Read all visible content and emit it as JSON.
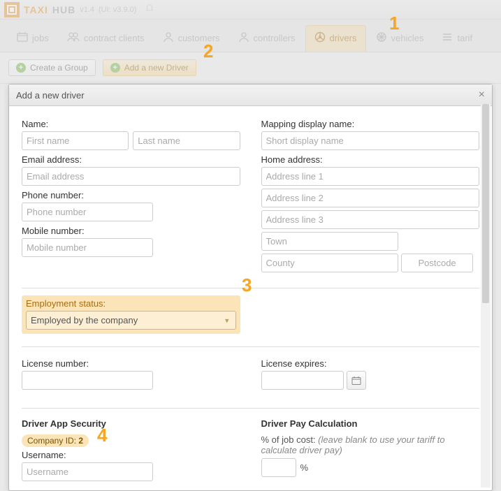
{
  "brand": {
    "part1": "TAXI",
    "part2": "HUB",
    "ver": "v1.4",
    "uiver": "(UI: v3.9.0)"
  },
  "tabs": {
    "jobs": "jobs",
    "contract": "contract clients",
    "customers": "customers",
    "controllers": "controllers",
    "drivers": "drivers",
    "vehicles": "vehicles",
    "tariffs": "tarif"
  },
  "toolbar": {
    "create_group": "Create a Group",
    "add_driver": "Add a new Driver"
  },
  "modal": {
    "title": "Add a new driver",
    "labels": {
      "name": "Name:",
      "email": "Email address:",
      "phone": "Phone number:",
      "mobile": "Mobile number:",
      "mapping": "Mapping display name:",
      "home": "Home address:",
      "employment": "Employment status:",
      "license_no": "License number:",
      "license_exp": "License expires:",
      "sec_title": "Driver App Security",
      "company_id_label": "Company ID:",
      "company_id_value": "2",
      "username": "Username:",
      "pay_title": "Driver Pay Calculation",
      "pct_label": "% of job cost:",
      "pct_hint": "(leave blank to use your tariff to calculate driver pay)",
      "pct_sign": "%"
    },
    "placeholders": {
      "first": "First name",
      "last": "Last name",
      "email": "Email address",
      "phone": "Phone number",
      "mobile": "Mobile number",
      "mapping": "Short display name",
      "addr1": "Address line 1",
      "addr2": "Address line 2",
      "addr3": "Address line 3",
      "town": "Town",
      "county": "County",
      "postcode": "Postcode",
      "username": "Username"
    },
    "employment_value": "Employed by the company"
  },
  "callouts": {
    "c1": "1",
    "c2": "2",
    "c3": "3",
    "c4": "4"
  }
}
